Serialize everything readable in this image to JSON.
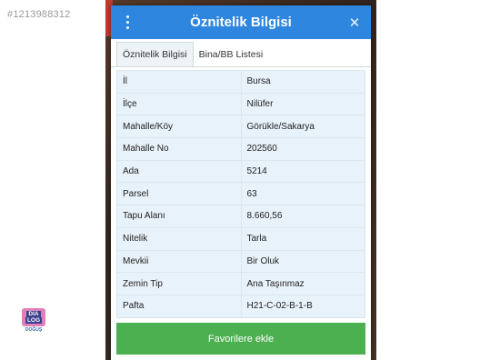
{
  "listing_id": "#1213988312",
  "dialog": {
    "title": "Öznitelik Bilgisi",
    "menu_icon": "more-vertical-icon",
    "close_icon": "close-icon",
    "close_glyph": "✕"
  },
  "tabs": [
    {
      "label": "Öznitelik Bilgisi",
      "active": true
    },
    {
      "label": "Bina/BB Listesi",
      "active": false
    }
  ],
  "attributes": [
    {
      "key": "İl",
      "value": "Bursa"
    },
    {
      "key": "İlçe",
      "value": "Nilüfer"
    },
    {
      "key": "Mahalle/Köy",
      "value": "Görükle/Sakarya"
    },
    {
      "key": "Mahalle No",
      "value": "202560"
    },
    {
      "key": "Ada",
      "value": "5214"
    },
    {
      "key": "Parsel",
      "value": "63"
    },
    {
      "key": "Tapu Alanı",
      "value": "8.660,56"
    },
    {
      "key": "Nitelik",
      "value": "Tarla"
    },
    {
      "key": "Mevkii",
      "value": "Bir Oluk"
    },
    {
      "key": "Zemin Tip",
      "value": "Ana Taşınmaz"
    },
    {
      "key": "Pafta",
      "value": "H21-C-02-B-1-B"
    }
  ],
  "footer_button": "Favorilere ekle",
  "logo": {
    "line1": "DIA",
    "line2": "LOG",
    "sub": "DOĞUŞ"
  },
  "colors": {
    "titlebar": "#2e86de",
    "footer": "#4caf50",
    "row": "#e8f2fa"
  }
}
